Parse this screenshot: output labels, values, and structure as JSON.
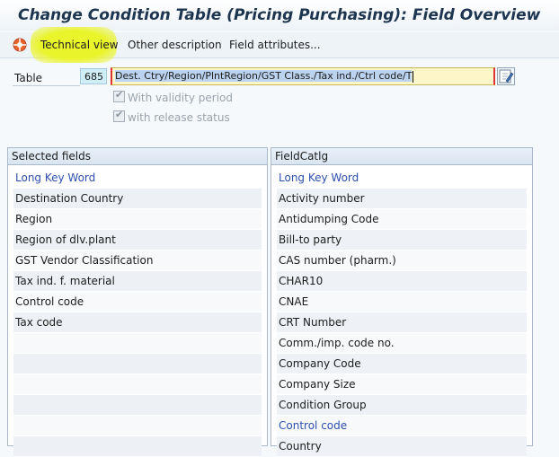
{
  "window": {
    "title": "Change Condition Table (Pricing Purchasing): Field Overview"
  },
  "toolbar": {
    "technical_view": "Technical view",
    "other_description": "Other description",
    "field_attributes": "Field attributes..."
  },
  "table": {
    "label": "Table",
    "number": "685",
    "description": "Dest. Ctry/Region/PlntRegion/GST Class./Tax ind./Ctrl code/T"
  },
  "options": {
    "validity_period": "With validity period",
    "release_status": "with release status"
  },
  "selected_fields": {
    "title": "Selected fields",
    "header": "Long Key Word",
    "rows": [
      "Destination Country",
      "Region",
      "Region of dlv.plant",
      "GST Vendor Classification",
      "Tax ind. f. material",
      "Control code",
      "Tax code"
    ]
  },
  "field_catalog": {
    "title": "FieldCatlg",
    "header": "Long Key Word",
    "rows": [
      "Activity number",
      "Antidumping Code",
      "Bill-to party",
      "CAS number (pharm.)",
      "CHAR10",
      "CNAE",
      "CRT Number",
      "Comm./imp. code no.",
      "Company Code",
      "Company Size",
      "Condition Group",
      "Control code",
      "Country"
    ],
    "highlighted_row": "Control code"
  },
  "colors": {
    "title_text": "#1e3550",
    "header_blue": "#2f4fb0",
    "highlight_yellow": "#eaf42a",
    "table_number_bg": "#cfeef8",
    "description_bg": "#fcf6c8"
  }
}
